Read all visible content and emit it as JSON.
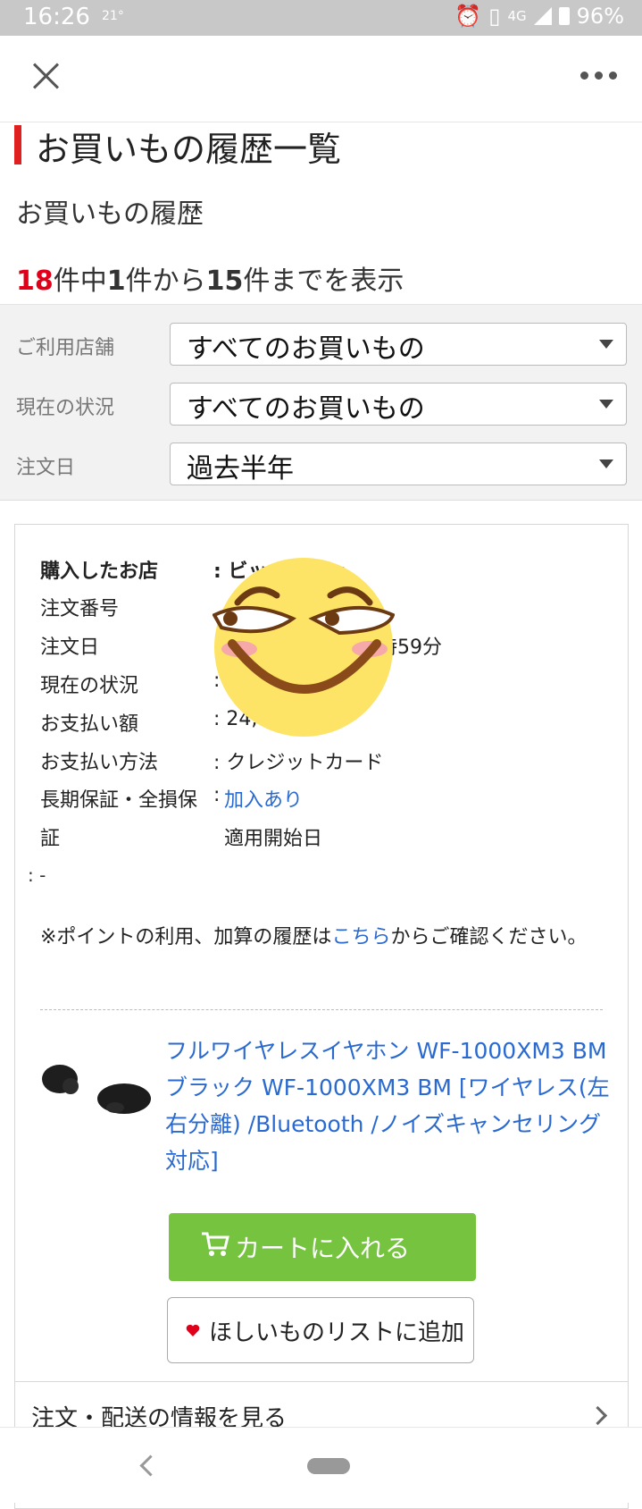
{
  "status_bar": {
    "time": "16:26",
    "temperature": "21°",
    "network": "4G",
    "battery": "96%"
  },
  "page": {
    "title": "お買いもの履歴一覧",
    "subtitle": "お買いもの履歴",
    "count": {
      "total": "18",
      "t1": "件中",
      "from": "1",
      "t2": "件から",
      "to": "15",
      "t3": "件までを表示"
    }
  },
  "filters": [
    {
      "label": "ご利用店舗",
      "value": "すべてのお買いもの"
    },
    {
      "label": "現在の状況",
      "value": "すべてのお買いもの"
    },
    {
      "label": "注文日",
      "value": "過去半年"
    }
  ],
  "order": {
    "rows": [
      {
        "label": "購入したお店",
        "value": ": ビッ       ラ.com"
      },
      {
        "label": "注文番号",
        "value": ""
      },
      {
        "label": "注文日",
        "value": "時59分"
      },
      {
        "label": "現在の状況",
        "value": ":"
      },
      {
        "label": "お支払い額",
        "value": ": 24,6"
      },
      {
        "label": "お支払い方法",
        "value": ": クレジットカード"
      },
      {
        "label": "長期保証・全損保",
        "value": "加入あり"
      },
      {
        "label": "証",
        "value": "適用開始日"
      }
    ],
    "warranty_colon": ":",
    "orphan": ": -",
    "note": {
      "pre": "※ポイントの利用、加算の履歴は",
      "link": "こちら",
      "post": "からご確認ください。"
    },
    "product_title": "フルワイヤレスイヤホン WF-1000XM3 BM ブラック WF-1000XM3 BM [ワイヤレス(左右分離) /Bluetooth /ノイズキャンセリング対応]",
    "cart_button": "カートに入れる",
    "wishlist_button": "ほしいものリストに追加",
    "detail_link": "注文・配送の情報を見る"
  },
  "colors": {
    "accent_red": "#e02020",
    "link_blue": "#2a6ad0",
    "cart_green": "#75c33f"
  }
}
